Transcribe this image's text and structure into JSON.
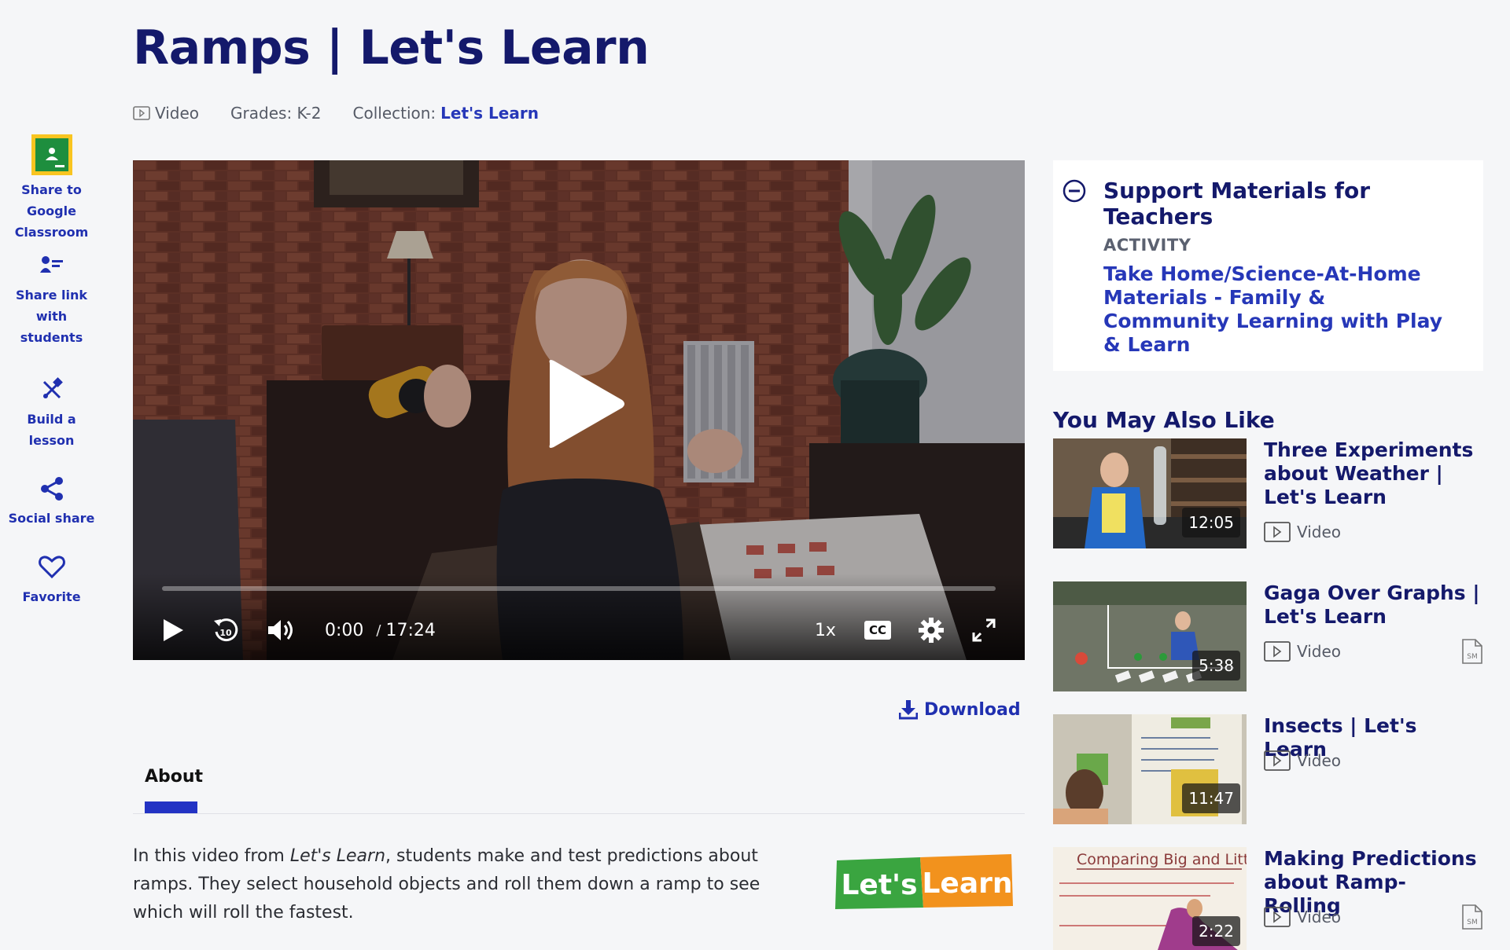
{
  "page": {
    "title": "Ramps | Let's Learn",
    "meta": {
      "type_label": "Video",
      "grades": "Grades: K-2",
      "collection_prefix": "Collection:",
      "collection_link": "Let's Learn"
    }
  },
  "share_rail": [
    {
      "label": "Share to Google Classroom",
      "icon": "google-classroom-icon"
    },
    {
      "label": "Share link with students",
      "icon": "share-link-icon"
    },
    {
      "label": "Build a lesson",
      "icon": "build-lesson-icon"
    },
    {
      "label": "Social share",
      "icon": "share-icon"
    },
    {
      "label": "Favorite",
      "icon": "heart-icon"
    }
  ],
  "player": {
    "current_time": "0:00",
    "separator": "/",
    "duration": "17:24",
    "playback_rate": "1x",
    "cc_label": "CC",
    "progress": 0
  },
  "download": {
    "label": "Download"
  },
  "tabs": [
    {
      "label": "About",
      "active": true
    }
  ],
  "about": {
    "prefix": "In this video from ",
    "series": "Let's Learn",
    "suffix": ", students make and test predictions about ramps. They select household objects and roll them down a ramp to see which will roll the fastest.",
    "logo_text_left": "Let's",
    "logo_text_right": "Learn"
  },
  "support": {
    "heading": "Support Materials for Teachers",
    "kind": "ACTIVITY",
    "link": "Take Home/Science-At-Home Materials - Family & Community Learning with Play & Learn"
  },
  "related": {
    "heading": "You May Also Like",
    "items": [
      {
        "title": "Three Experiments about Weather | Let's Learn",
        "type": "Video",
        "duration": "12:05",
        "has_support": false
      },
      {
        "title": "Gaga Over Graphs | Let's Learn",
        "type": "Video",
        "duration": "5:38",
        "has_support": true
      },
      {
        "title": "Insects | Let's Learn",
        "type": "Video",
        "duration": "11:47",
        "has_support": false
      },
      {
        "title": "Making Predictions about Ramp-Rolling",
        "type": "Video",
        "duration": "2:22",
        "has_support": true,
        "thumb_text": "Comparing Big and Littl"
      }
    ]
  },
  "colors": {
    "brand_navy": "#14196b",
    "link_blue": "#2637b8",
    "accent_tab": "#2333c4",
    "logo_green": "#3aa540",
    "logo_orange": "#f2921d"
  }
}
